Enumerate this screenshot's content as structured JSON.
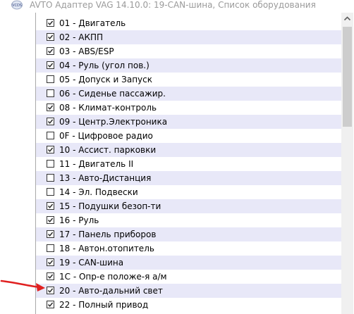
{
  "window": {
    "title": "AVTO Адаптер VAG 14.10.0: 19-CAN-шина,  Список оборудования"
  },
  "app_icon": "vcds-app-icon",
  "colors": {
    "alt_row": "#e8e8f8",
    "annotation_arrow": "#e02020",
    "title_text": "#9a9a9a"
  },
  "list": {
    "items": [
      {
        "label": "01 - Двигатель",
        "checked": true
      },
      {
        "label": "02 - АКПП",
        "checked": true
      },
      {
        "label": "03 - ABS/ESP",
        "checked": true
      },
      {
        "label": "04 - Руль (угол пов.)",
        "checked": true
      },
      {
        "label": "05 - Допуск и Запуск",
        "checked": false
      },
      {
        "label": "06 - Сиденье пассажир.",
        "checked": false
      },
      {
        "label": "08 - Климат-контроль",
        "checked": true
      },
      {
        "label": "09 - Центр.Электроника",
        "checked": true
      },
      {
        "label": "0F - Цифровое радио",
        "checked": false
      },
      {
        "label": "10 - Ассист. парковки",
        "checked": true
      },
      {
        "label": "11 - Двигатель II",
        "checked": false
      },
      {
        "label": "13 - Авто-Дистанция",
        "checked": false
      },
      {
        "label": "14 - Эл. Подвески",
        "checked": false
      },
      {
        "label": "15 - Подушки безоп-ти",
        "checked": true
      },
      {
        "label": "16 - Руль",
        "checked": true
      },
      {
        "label": "17 - Панель приборов",
        "checked": true
      },
      {
        "label": "18 - Автон.отопитель",
        "checked": false
      },
      {
        "label": "19 - CAN-шина",
        "checked": true
      },
      {
        "label": "1C - Опр-е положе-я а/м",
        "checked": true
      },
      {
        "label": "20 - Авто-дальний свет",
        "checked": true
      },
      {
        "label": "22 - Полный привод",
        "checked": true
      }
    ]
  }
}
